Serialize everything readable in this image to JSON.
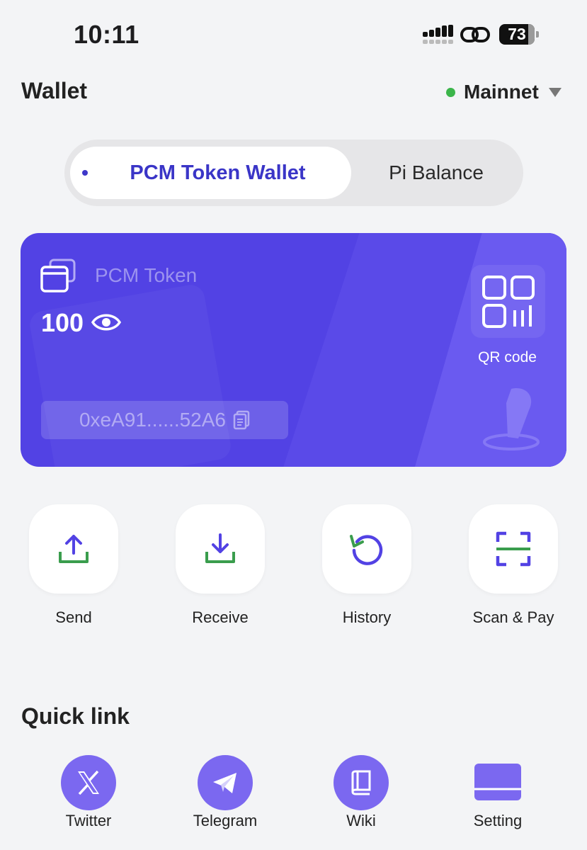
{
  "status_bar": {
    "time": "10:11",
    "battery": "73"
  },
  "header": {
    "title": "Wallet",
    "network": "Mainnet"
  },
  "tabs": {
    "active": "PCM Token Wallet",
    "inactive": "Pi Balance"
  },
  "card": {
    "token_name": "PCM Token",
    "balance": "100",
    "qr_label": "QR code",
    "address": "0xeA91......52A6"
  },
  "actions": [
    {
      "label": "Send"
    },
    {
      "label": "Receive"
    },
    {
      "label": "History"
    },
    {
      "label": "Scan & Pay"
    }
  ],
  "quick_links": {
    "title": "Quick link",
    "items": [
      {
        "label": "Twitter"
      },
      {
        "label": "Telegram"
      },
      {
        "label": "Wiki"
      },
      {
        "label": "Setting"
      }
    ]
  },
  "colors": {
    "accent": "#5242e4",
    "accent_light": "#7b68f0",
    "green": "#3a9d4d",
    "network_dot": "#3bb54a"
  }
}
